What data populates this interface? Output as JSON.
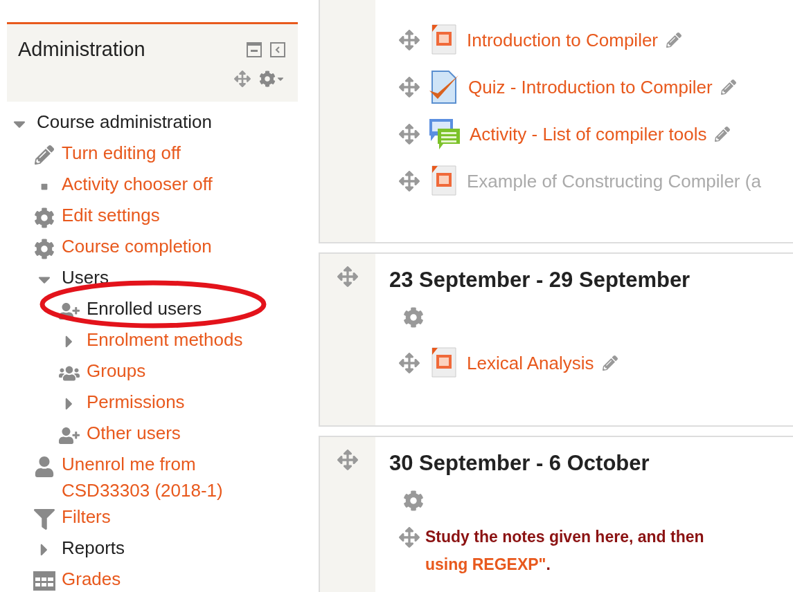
{
  "block": {
    "title": "Administration"
  },
  "tree": [
    {
      "label": "Course administration",
      "kind": "branch",
      "expanded": true,
      "link": false,
      "children": [
        {
          "label": "Turn editing off",
          "kind": "pencil",
          "link": true
        },
        {
          "label": "Activity chooser off",
          "kind": "square",
          "link": true
        },
        {
          "label": "Edit settings",
          "kind": "gear",
          "link": true
        },
        {
          "label": "Course completion",
          "kind": "gear",
          "link": true
        },
        {
          "label": "Users",
          "kind": "branch",
          "expanded": true,
          "link": false,
          "children": [
            {
              "label": "Enrolled users",
              "kind": "user-add",
              "link": false
            },
            {
              "label": "Enrolment methods",
              "kind": "branch",
              "expanded": false,
              "link": true
            },
            {
              "label": "Groups",
              "kind": "users",
              "link": true
            },
            {
              "label": "Permissions",
              "kind": "branch",
              "expanded": false,
              "link": true
            },
            {
              "label": "Other users",
              "kind": "user-add",
              "link": true
            }
          ]
        },
        {
          "label": "Unenrol me from CSD33303 (2018-1)",
          "kind": "user",
          "link": true
        },
        {
          "label": "Filters",
          "kind": "filter",
          "link": true
        },
        {
          "label": "Reports",
          "kind": "branch",
          "expanded": false,
          "link": false
        },
        {
          "label": "Grades",
          "kind": "table",
          "link": true
        }
      ]
    }
  ],
  "sections": [
    {
      "activities": [
        {
          "title": "Introduction to Compiler",
          "kind": "ppt",
          "hidden": false,
          "editable": true
        },
        {
          "title": "Quiz - Introduction to Compiler",
          "kind": "quiz",
          "hidden": false,
          "editable": true
        },
        {
          "title": "Activity - List of compiler tools",
          "kind": "forum",
          "hidden": false,
          "editable": true
        },
        {
          "title": "Example of Constructing Compiler (a",
          "kind": "ppt",
          "hidden": true,
          "editable": false
        }
      ]
    },
    {
      "heading": "23 September - 29 September",
      "activities": [
        {
          "title": "Lexical Analysis",
          "kind": "ppt",
          "hidden": false,
          "editable": true
        }
      ]
    },
    {
      "heading": "30 September - 6 October",
      "label": {
        "text": "Study the notes given here, and then",
        "link": "using REGEXP\"",
        "tail": "."
      }
    }
  ]
}
